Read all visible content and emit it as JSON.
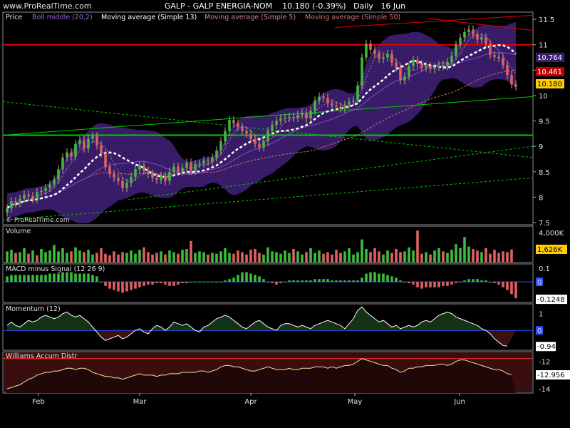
{
  "header": {
    "site": "www.ProRealTime.com",
    "instrument": "GALP - GALP ENERGIA-NOM",
    "last": "10.180 (-0.39%)",
    "period": "Daily",
    "date": "16 Jun"
  },
  "colors": {
    "background": "#000000",
    "up_candle": "#3dbb3d",
    "down_candle": "#e06060",
    "boll_band": "#3b1e6e",
    "ma13": "#ffffff",
    "ma5": "#b57aa0",
    "ma50": "#d07070",
    "resistance": "#e00000",
    "support": "#00cc00",
    "volume_up": "#3dbb3d",
    "volume_down": "#e06060"
  },
  "chart_data": [
    {
      "type": "candlestick",
      "panel": "Price",
      "legend": [
        "Price",
        "Boll middle (20,2)",
        "Moving average (Simple 13)",
        "Moving average (Simple 5)",
        "Moving average (Simple 50)"
      ],
      "watermark": "© ProRealTime.com",
      "y_ticks": [
        "11.5",
        "11",
        "10.5",
        "10",
        "9.5",
        "9",
        "8.5",
        "8",
        "7.5"
      ],
      "ylim": [
        7.5,
        11.6
      ],
      "x_ticks": [
        "Feb",
        "Mar",
        "Apr",
        "May",
        "Jun"
      ],
      "value_labels": [
        "10.764",
        "10.461",
        "10.180"
      ],
      "close": [
        7.78,
        7.92,
        7.88,
        7.97,
        8.05,
        8.02,
        7.96,
        8.1,
        8.12,
        8.18,
        8.25,
        8.35,
        8.55,
        8.78,
        8.88,
        8.8,
        9.05,
        9.12,
        8.96,
        9.15,
        9.2,
        9.02,
        8.86,
        8.6,
        8.46,
        8.38,
        8.32,
        8.18,
        8.28,
        8.4,
        8.55,
        8.62,
        8.52,
        8.46,
        8.38,
        8.34,
        8.42,
        8.32,
        8.5,
        8.6,
        8.5,
        8.58,
        8.68,
        8.52,
        8.65,
        8.66,
        8.72,
        8.7,
        8.78,
        8.92,
        9.1,
        9.3,
        9.52,
        9.45,
        9.38,
        9.3,
        9.25,
        9.14,
        9.05,
        8.98,
        9.1,
        9.3,
        9.42,
        9.5,
        9.55,
        9.56,
        9.58,
        9.56,
        9.62,
        9.66,
        9.55,
        9.7,
        9.9,
        9.98,
        9.95,
        9.85,
        9.8,
        9.78,
        9.74,
        9.82,
        9.88,
        9.9,
        10.2,
        10.75,
        11.02,
        10.9,
        10.82,
        10.72,
        10.75,
        10.82,
        10.65,
        10.55,
        10.3,
        10.38,
        10.58,
        10.7,
        10.62,
        10.55,
        10.58,
        10.52,
        10.56,
        10.6,
        10.58,
        10.66,
        10.78,
        11.0,
        11.14,
        11.25,
        11.3,
        11.2,
        11.1,
        11.15,
        11.02,
        10.8,
        10.76,
        10.74,
        10.6,
        10.4,
        10.22,
        10.18
      ],
      "open": [
        7.7,
        7.78,
        7.92,
        7.88,
        7.97,
        8.05,
        8.02,
        7.96,
        8.1,
        8.12,
        8.18,
        8.25,
        8.35,
        8.55,
        8.78,
        8.88,
        8.8,
        9.05,
        9.12,
        8.96,
        9.15,
        9.2,
        9.02,
        8.86,
        8.6,
        8.46,
        8.38,
        8.32,
        8.18,
        8.28,
        8.4,
        8.55,
        8.62,
        8.52,
        8.46,
        8.38,
        8.34,
        8.42,
        8.32,
        8.5,
        8.6,
        8.5,
        8.58,
        8.68,
        8.52,
        8.65,
        8.66,
        8.72,
        8.7,
        8.78,
        8.92,
        9.1,
        9.3,
        9.52,
        9.45,
        9.38,
        9.3,
        9.25,
        9.14,
        9.05,
        8.98,
        9.1,
        9.3,
        9.42,
        9.5,
        9.55,
        9.56,
        9.58,
        9.56,
        9.62,
        9.66,
        9.55,
        9.7,
        9.9,
        9.98,
        9.95,
        9.85,
        9.8,
        9.78,
        9.74,
        9.82,
        9.88,
        9.9,
        10.2,
        10.75,
        11.02,
        10.9,
        10.82,
        10.72,
        10.75,
        10.82,
        10.65,
        10.55,
        10.3,
        10.38,
        10.58,
        10.7,
        10.62,
        10.55,
        10.58,
        10.52,
        10.56,
        10.6,
        10.58,
        10.66,
        10.78,
        11.0,
        11.14,
        11.25,
        11.3,
        11.2,
        11.1,
        11.15,
        11.02,
        10.8,
        10.76,
        10.74,
        10.6,
        10.4,
        10.22
      ],
      "trendlines": [
        {
          "kind": "horizontal",
          "y": 11.0,
          "color": "resistance"
        },
        {
          "kind": "horizontal",
          "y": 9.15,
          "color": "support"
        }
      ]
    },
    {
      "type": "bar",
      "panel": "Volume",
      "y_ticks": [
        "4,000K"
      ],
      "value_label": "1,626K",
      "ylim": [
        0,
        4200
      ],
      "values": [
        1400,
        1600,
        1200,
        1300,
        1800,
        1100,
        1500,
        900,
        1700,
        1300,
        1500,
        2200,
        1400,
        1800,
        1200,
        1400,
        1900,
        1500,
        1300,
        1600,
        1000,
        1200,
        1800,
        1100,
        900,
        1400,
        1000,
        1300,
        1200,
        1500,
        1100,
        1600,
        1900,
        1300,
        1000,
        1200,
        1400,
        1000,
        1500,
        1300,
        1100,
        1600,
        1700,
        2700,
        1200,
        1400,
        1300,
        1000,
        1200,
        1100,
        1400,
        1800,
        1200,
        1100,
        1500,
        1300,
        1000,
        1600,
        1700,
        1200,
        1000,
        1900,
        1400,
        1300,
        1100,
        1500,
        1200,
        1700,
        1400,
        1000,
        1300,
        1800,
        1200,
        1500,
        1100,
        1300,
        1000,
        1600,
        1200,
        1400,
        1800,
        1000,
        1300,
        2900,
        1700,
        1300,
        1800,
        1400,
        1000,
        1500,
        1200,
        1700,
        1300,
        1400,
        1900,
        1500,
        4000,
        1100,
        1300,
        1000,
        1500,
        1800,
        1400,
        1200,
        1600,
        2300,
        1800,
        3200,
        2000,
        1700,
        1500,
        1300,
        1800,
        1100,
        1600,
        1200,
        1400,
        1300,
        1626
      ],
      "up": [
        1,
        1,
        0,
        1,
        1,
        0,
        1,
        0,
        1,
        1,
        1,
        1,
        1,
        1,
        1,
        0,
        1,
        1,
        0,
        1,
        1,
        0,
        0,
        0,
        0,
        0,
        0,
        0,
        1,
        1,
        1,
        1,
        0,
        0,
        0,
        0,
        1,
        0,
        1,
        1,
        0,
        1,
        1,
        0,
        1,
        1,
        1,
        0,
        1,
        1,
        1,
        1,
        1,
        0,
        0,
        0,
        0,
        0,
        0,
        0,
        1,
        1,
        1,
        1,
        1,
        1,
        1,
        0,
        1,
        1,
        0,
        1,
        1,
        1,
        0,
        0,
        0,
        0,
        0,
        1,
        1,
        1,
        1,
        1,
        1,
        0,
        0,
        0,
        1,
        1,
        0,
        0,
        0,
        1,
        1,
        1,
        0,
        0,
        1,
        0,
        1,
        1,
        0,
        1,
        1,
        1,
        1,
        1,
        1,
        0,
        0,
        1,
        0,
        0,
        0,
        0,
        0,
        0,
        0
      ]
    },
    {
      "type": "bar",
      "panel": "MACD minus Signal (12 26 9)",
      "y_ticks": [
        "0.1",
        "0"
      ],
      "value_label": "-0.1248",
      "ylim": [
        -0.14,
        0.12
      ],
      "values": [
        0.04,
        0.05,
        0.05,
        0.05,
        0.05,
        0.05,
        0.05,
        0.05,
        0.05,
        0.05,
        0.06,
        0.06,
        0.06,
        0.07,
        0.07,
        0.07,
        0.06,
        0.06,
        0.06,
        0.06,
        0.05,
        0.04,
        0.0,
        -0.03,
        -0.05,
        -0.06,
        -0.07,
        -0.08,
        -0.07,
        -0.06,
        -0.05,
        -0.04,
        -0.03,
        -0.02,
        -0.02,
        -0.01,
        -0.01,
        -0.02,
        -0.03,
        -0.03,
        -0.02,
        -0.01,
        -0.01,
        0.0,
        0.0,
        0.0,
        0.0,
        0.0,
        0.0,
        0.0,
        0.0,
        0.01,
        0.02,
        0.03,
        0.05,
        0.07,
        0.07,
        0.06,
        0.05,
        0.04,
        0.02,
        0.0,
        -0.01,
        -0.02,
        -0.01,
        0.0,
        0.01,
        0.01,
        0.01,
        0.01,
        0.01,
        0.01,
        0.02,
        0.02,
        0.02,
        0.02,
        0.01,
        0.01,
        0.01,
        0.01,
        0.01,
        0.01,
        0.01,
        0.03,
        0.06,
        0.07,
        0.07,
        0.06,
        0.06,
        0.05,
        0.04,
        0.03,
        0.01,
        0.0,
        -0.01,
        -0.02,
        -0.04,
        -0.05,
        -0.04,
        -0.04,
        -0.04,
        -0.04,
        -0.03,
        -0.03,
        -0.02,
        -0.01,
        0.0,
        0.01,
        0.02,
        0.02,
        0.02,
        0.01,
        0.01,
        0.0,
        -0.01,
        -0.02,
        -0.04,
        -0.06,
        -0.09,
        -0.12
      ],
      "zero_line": 0
    },
    {
      "type": "area",
      "panel": "Momentum (12)",
      "y_ticks": [
        "1",
        "0"
      ],
      "value_label": "-0.94",
      "ylim": [
        -1.1,
        1.5
      ],
      "values": [
        0.3,
        0.5,
        0.3,
        0.2,
        0.4,
        0.6,
        0.5,
        0.6,
        0.8,
        0.9,
        0.8,
        0.7,
        0.8,
        1.0,
        1.1,
        0.9,
        0.8,
        0.9,
        0.7,
        0.5,
        0.2,
        -0.1,
        -0.4,
        -0.6,
        -0.5,
        -0.4,
        -0.3,
        -0.5,
        -0.4,
        -0.2,
        0.0,
        0.1,
        -0.1,
        -0.2,
        0.1,
        0.3,
        0.2,
        0.0,
        0.2,
        0.5,
        0.4,
        0.3,
        0.4,
        0.2,
        0.0,
        -0.1,
        0.2,
        0.3,
        0.5,
        0.7,
        0.8,
        0.9,
        0.8,
        0.6,
        0.4,
        0.2,
        0.1,
        0.3,
        0.5,
        0.6,
        0.4,
        0.2,
        0.1,
        0.0,
        0.3,
        0.4,
        0.4,
        0.3,
        0.2,
        0.3,
        0.2,
        0.1,
        0.3,
        0.4,
        0.5,
        0.6,
        0.5,
        0.4,
        0.3,
        0.1,
        0.4,
        0.7,
        1.2,
        1.4,
        1.1,
        0.9,
        0.7,
        0.5,
        0.6,
        0.4,
        0.2,
        0.3,
        0.1,
        0.2,
        0.3,
        0.2,
        0.3,
        0.5,
        0.6,
        0.5,
        0.7,
        0.9,
        1.0,
        1.1,
        1.0,
        0.8,
        0.7,
        0.6,
        0.5,
        0.4,
        0.3,
        0.1,
        0.0,
        -0.2,
        -0.5,
        -0.7,
        -0.9,
        -0.94
      ],
      "zero_line": 0
    },
    {
      "type": "line",
      "panel": "Williams Accum Distr",
      "y_ticks": [
        "-12",
        "-13",
        "-14"
      ],
      "value_label": "-12.956",
      "ylim": [
        -14.2,
        -11.4
      ],
      "values": [
        -14.0,
        -13.9,
        -13.8,
        -13.7,
        -13.5,
        -13.3,
        -13.2,
        -13.0,
        -12.9,
        -12.8,
        -12.8,
        -12.7,
        -12.7,
        -12.6,
        -12.5,
        -12.5,
        -12.6,
        -12.5,
        -12.5,
        -12.6,
        -12.8,
        -12.9,
        -13.0,
        -13.1,
        -13.1,
        -13.2,
        -13.2,
        -13.3,
        -13.2,
        -13.1,
        -13.0,
        -12.9,
        -13.0,
        -13.0,
        -13.0,
        -13.1,
        -13.0,
        -13.0,
        -12.9,
        -12.9,
        -12.9,
        -12.8,
        -12.8,
        -12.8,
        -12.8,
        -12.7,
        -12.7,
        -12.8,
        -12.7,
        -12.6,
        -12.4,
        -12.3,
        -12.3,
        -12.4,
        -12.4,
        -12.5,
        -12.6,
        -12.7,
        -12.7,
        -12.6,
        -12.5,
        -12.4,
        -12.5,
        -12.6,
        -12.6,
        -12.6,
        -12.5,
        -12.6,
        -12.6,
        -12.5,
        -12.5,
        -12.5,
        -12.4,
        -12.4,
        -12.4,
        -12.5,
        -12.4,
        -12.5,
        -12.4,
        -12.3,
        -12.3,
        -12.2,
        -12.0,
        -11.8,
        -11.9,
        -12.0,
        -12.1,
        -12.2,
        -12.3,
        -12.3,
        -12.5,
        -12.6,
        -12.8,
        -12.7,
        -12.5,
        -12.5,
        -12.4,
        -12.4,
        -12.3,
        -12.3,
        -12.3,
        -12.2,
        -12.2,
        -12.3,
        -12.2,
        -12.0,
        -11.9,
        -11.9,
        -12.0,
        -12.1,
        -12.2,
        -12.3,
        -12.4,
        -12.5,
        -12.6,
        -12.6,
        -12.7,
        -12.9,
        -12.956
      ]
    }
  ]
}
